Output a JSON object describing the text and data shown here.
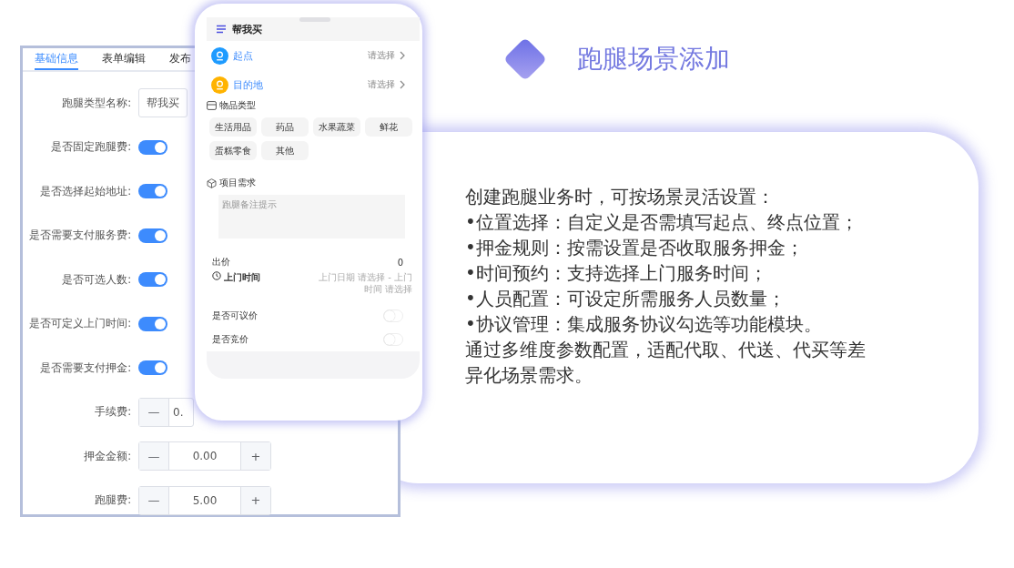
{
  "admin_panel": {
    "tabs": [
      {
        "label": "基础信息",
        "selected": true
      },
      {
        "label": "表单编辑",
        "selected": false
      },
      {
        "label": "发布",
        "selected": false
      }
    ],
    "fields": [
      {
        "kind": "text",
        "label": "跑腿类型名称:",
        "value": "帮我买"
      },
      {
        "kind": "toggle",
        "label": "是否固定跑腿费:",
        "on": true
      },
      {
        "kind": "toggle",
        "label": "是否选择起始地址:",
        "on": true
      },
      {
        "kind": "toggle",
        "label": "是否需要支付服务费:",
        "on": true
      },
      {
        "kind": "toggle",
        "label": "是否可选人数:",
        "on": true
      },
      {
        "kind": "toggle",
        "label": "是否可定义上门时间:",
        "on": true
      },
      {
        "kind": "toggle",
        "label": "是否需要支付押金:",
        "on": true
      },
      {
        "kind": "stepper",
        "label": "手续费:",
        "minus": "—",
        "value": "0."
      },
      {
        "kind": "stepper",
        "label": "押金金额:",
        "minus": "—",
        "value": "0.00",
        "plus": "+"
      },
      {
        "kind": "stepper",
        "label": "跑腿费:",
        "minus": "—",
        "value": "5.00",
        "plus": "+"
      }
    ]
  },
  "phone": {
    "title": "帮我买",
    "locations": [
      {
        "label": "起点",
        "action": "请选择",
        "color": "#1e9bff"
      },
      {
        "label": "目的地",
        "action": "请选择",
        "color": "#ffb300"
      }
    ],
    "item_type": {
      "heading": "物品类型",
      "chips": [
        "生活用品",
        "药品",
        "水果蔬菜",
        "鲜花",
        "蛋糕零食",
        "其他"
      ]
    },
    "requirements": {
      "heading": "项目需求",
      "placeholder": "跑腿备注提示"
    },
    "bid": {
      "label": "出价",
      "value": "0"
    },
    "visit_time": {
      "label": "上门时间",
      "value": "上门日期 请选择 - 上门时间 请选择"
    },
    "switches": [
      {
        "label": "是否可议价",
        "on": false
      },
      {
        "label": "是否竞价",
        "on": false
      }
    ]
  },
  "feature": {
    "title": "跑腿场景添加",
    "lines": [
      "创建跑腿业务时，可按场景灵活设置：",
      "•位置选择：自定义是否需填写起点、终点位置；",
      "•押金规则：按需设置是否收取服务押金；",
      "•时间预约：支持选择上门服务时间；",
      "•人员配置：可设定所需服务人员数量；",
      "•协议管理：集成服务协议勾选等功能模块。",
      "通过多维度参数配置，适配代取、代送、代买等差异化场景需求。"
    ]
  }
}
